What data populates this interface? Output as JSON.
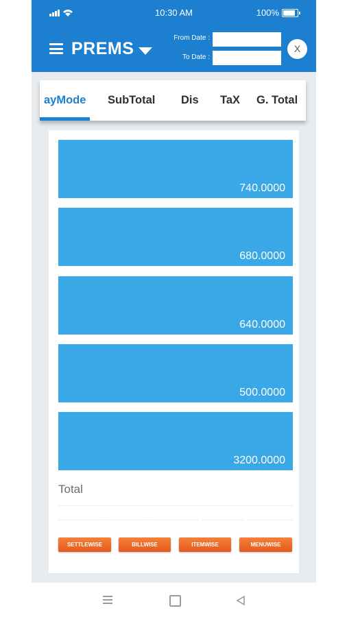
{
  "status_bar": {
    "time": "10:30 AM",
    "battery": "100%"
  },
  "app_bar": {
    "title": "PREMS",
    "from_date_label": "From Date :",
    "to_date_label": "To Date :",
    "from_date_value": "",
    "to_date_value": "",
    "close_label": "X"
  },
  "tabs": [
    {
      "label": "ayMode",
      "active": true
    },
    {
      "label": "SubTotal"
    },
    {
      "label": "Dis"
    },
    {
      "label": "TaX"
    },
    {
      "label": "G. Total"
    }
  ],
  "rows": [
    {
      "value": "740.0000"
    },
    {
      "value": "680.0000"
    },
    {
      "value": "640.0000"
    },
    {
      "value": "500.0000"
    },
    {
      "value": "3200.0000"
    }
  ],
  "total_label": "Total",
  "buttons": [
    "SETTLEWISE",
    "BILLWISE",
    "ITEMWISE",
    "MENUWISE"
  ],
  "colors": {
    "primary": "#1c7fd0",
    "bar": "#3aa8e6",
    "button": "#e8621f"
  }
}
